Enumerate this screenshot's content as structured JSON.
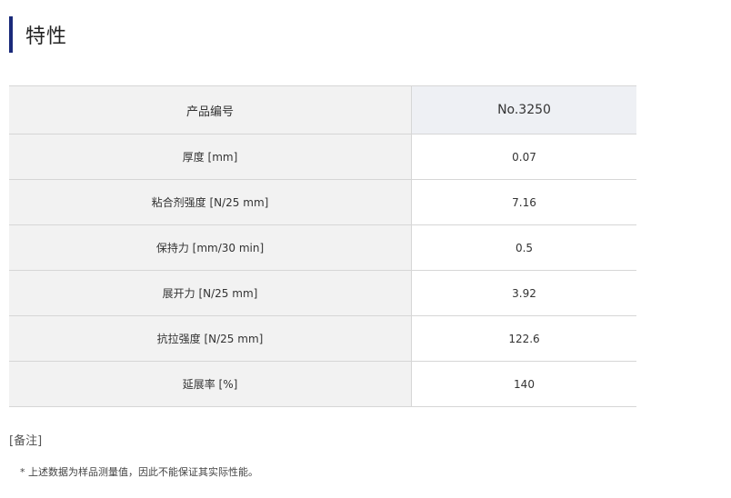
{
  "section": {
    "title": "特性"
  },
  "table": {
    "header": {
      "label": "产品编号",
      "value": "No.3250"
    },
    "rows": [
      {
        "label": "厚度 [mm]",
        "value": "0.07"
      },
      {
        "label": "粘合剂强度 [N/25 mm]",
        "value": "7.16"
      },
      {
        "label": "保持力 [mm/30 min]",
        "value": "0.5"
      },
      {
        "label": "展开力 [N/25 mm]",
        "value": "3.92"
      },
      {
        "label": "抗拉强度 [N/25 mm]",
        "value": "122.6"
      },
      {
        "label": "延展率 [%]",
        "value": "140"
      }
    ]
  },
  "notes": {
    "title": "[备注]",
    "items": [
      "* 上述数据为样品测量值，因此不能保证其实际性能。"
    ]
  },
  "colors": {
    "accent_bar": "#1a2a7a",
    "header_bg": "#eef0f4",
    "label_bg": "#f2f2f2",
    "border": "#d6d6d6"
  }
}
